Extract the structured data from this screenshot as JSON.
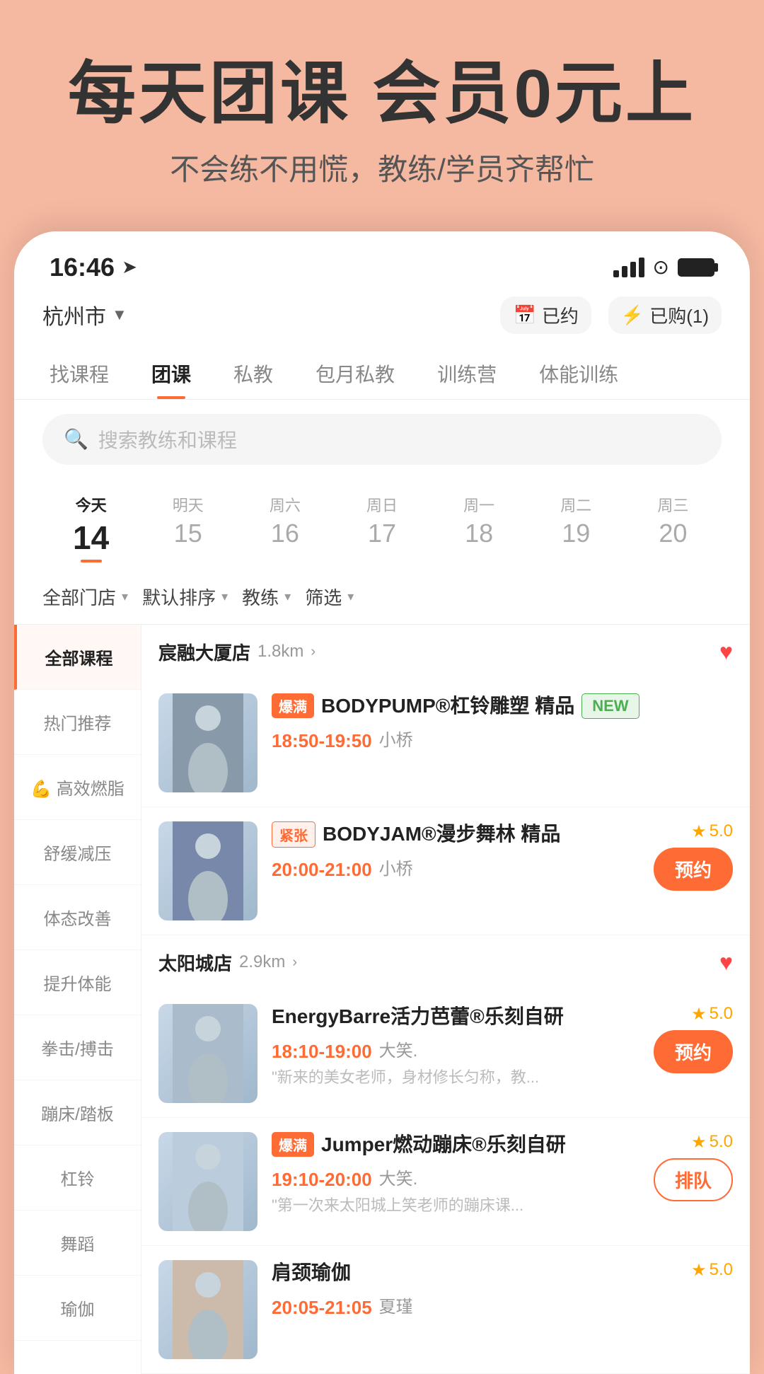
{
  "hero": {
    "title": "每天团课 会员0元上",
    "subtitle": "不会练不用慌，教练/学员齐帮忙"
  },
  "status_bar": {
    "time": "16:46",
    "location_icon": "▷"
  },
  "top_nav": {
    "location": "杭州市",
    "booked_label": "已约",
    "purchased_label": "已购(1)"
  },
  "tabs": [
    {
      "label": "找课程",
      "active": false
    },
    {
      "label": "团课",
      "active": true
    },
    {
      "label": "私教",
      "active": false
    },
    {
      "label": "包月私教",
      "active": false
    },
    {
      "label": "训练营",
      "active": false
    },
    {
      "label": "体能训练",
      "active": false
    }
  ],
  "search": {
    "placeholder": "搜索教练和课程"
  },
  "dates": [
    {
      "label": "今天",
      "num": "14",
      "today": true
    },
    {
      "label": "明天",
      "num": "15",
      "today": false
    },
    {
      "label": "周六",
      "num": "16",
      "today": false
    },
    {
      "label": "周日",
      "num": "17",
      "today": false
    },
    {
      "label": "周一",
      "num": "18",
      "today": false
    },
    {
      "label": "周二",
      "num": "19",
      "today": false
    },
    {
      "label": "周三",
      "num": "20",
      "today": false
    }
  ],
  "filters": [
    {
      "label": "全部门店"
    },
    {
      "label": "默认排序"
    },
    {
      "label": "教练"
    },
    {
      "label": "筛选"
    }
  ],
  "sidebar": {
    "items": [
      {
        "label": "全部课程",
        "active": true
      },
      {
        "label": "热门推荐",
        "active": false
      },
      {
        "label": "💪 高效燃脂",
        "active": false
      },
      {
        "label": "舒缓减压",
        "active": false
      },
      {
        "label": "体态改善",
        "active": false
      },
      {
        "label": "提升体能",
        "active": false
      },
      {
        "label": "拳击/搏击",
        "active": false
      },
      {
        "label": "蹦床/踏板",
        "active": false
      },
      {
        "label": "杠铃",
        "active": false
      },
      {
        "label": "舞蹈",
        "active": false
      },
      {
        "label": "瑜伽",
        "active": false
      }
    ]
  },
  "venues": [
    {
      "name": "宸融大厦店",
      "distance": "1.8km",
      "favorited": true,
      "courses": [
        {
          "badge": "爆满",
          "badge_type": "hot",
          "name": "BODYPUMP®杠铃雕塑 精品",
          "time": "18:50-19:50",
          "trainer": "小桥",
          "rating": null,
          "is_new": true,
          "desc": null,
          "action": null,
          "bg_color": "#8899aa"
        },
        {
          "badge": "紧张",
          "badge_type": "tight",
          "name": "BODYJAM®漫步舞林 精品",
          "time": "20:00-21:00",
          "trainer": "小桥",
          "rating": "5.0",
          "is_new": false,
          "desc": null,
          "action": "预约",
          "bg_color": "#7788aa"
        }
      ]
    },
    {
      "name": "太阳城店",
      "distance": "2.9km",
      "favorited": true,
      "courses": [
        {
          "badge": null,
          "badge_type": null,
          "name": "EnergyBarre活力芭蕾®乐刻自研",
          "time": "18:10-19:00",
          "trainer": "大笑.",
          "rating": "5.0",
          "is_new": false,
          "desc": "\"新来的美女老师，身材修长匀称，教...",
          "action": "预约",
          "bg_color": "#aabbcc"
        },
        {
          "badge": "爆满",
          "badge_type": "hot",
          "name": "Jumper燃动蹦床®乐刻自研",
          "time": "19:10-20:00",
          "trainer": "大笑.",
          "rating": "5.0",
          "is_new": false,
          "desc": "\"第一次来太阳城上笑老师的蹦床课...",
          "action": "排队",
          "bg_color": "#bbccdd"
        },
        {
          "badge": null,
          "badge_type": null,
          "name": "肩颈瑜伽",
          "time": "20:05-21:05",
          "trainer": "夏瑾",
          "rating": "5.0",
          "is_new": false,
          "desc": null,
          "action": null,
          "bg_color": "#ccbbaa"
        }
      ]
    }
  ]
}
